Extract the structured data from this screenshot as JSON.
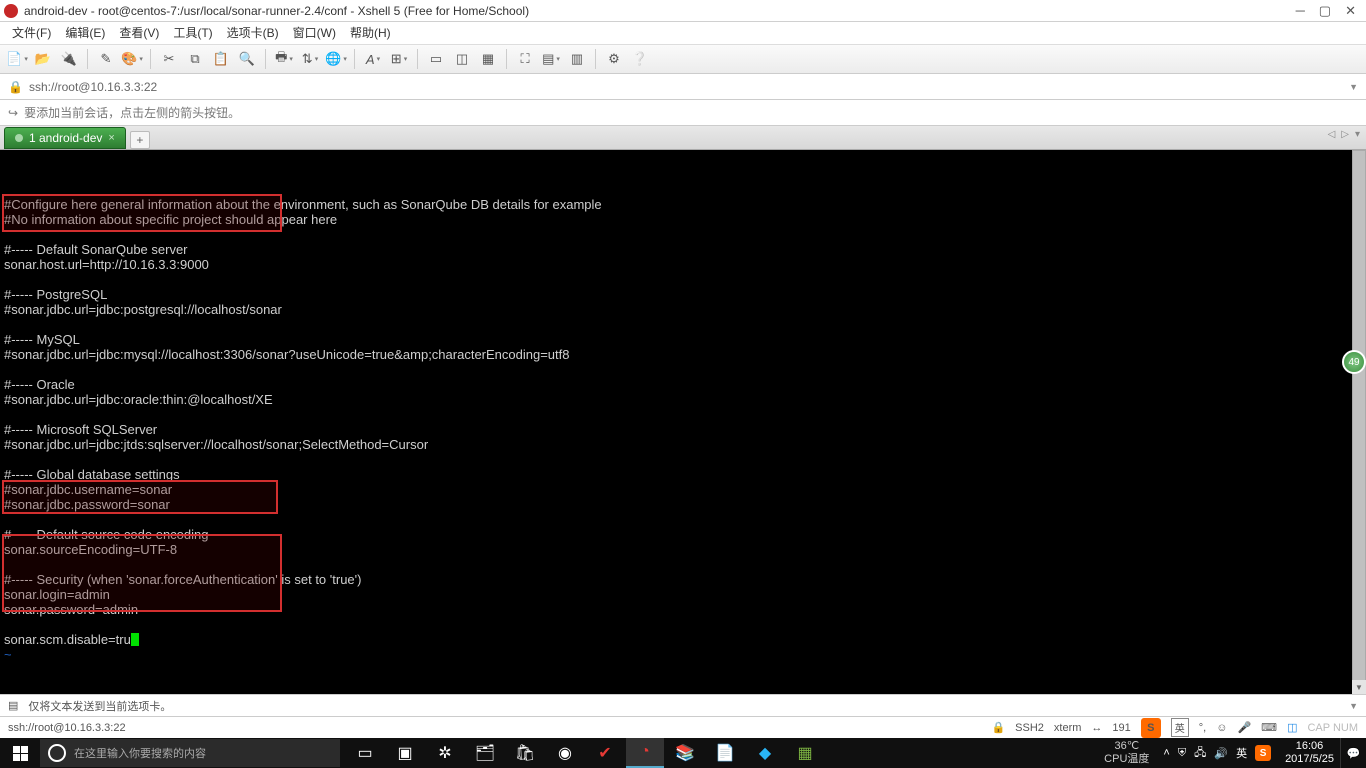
{
  "titlebar": {
    "text": "android-dev - root@centos-7:/usr/local/sonar-runner-2.4/conf - Xshell 5 (Free for Home/School)"
  },
  "menu": [
    "文件(F)",
    "编辑(E)",
    "查看(V)",
    "工具(T)",
    "选项卡(B)",
    "窗口(W)",
    "帮助(H)"
  ],
  "address": "ssh://root@10.16.3.3:22",
  "hint": "要添加当前会话，点击左侧的箭头按钮。",
  "tab": {
    "label": "1 android-dev"
  },
  "terminal": {
    "lines": [
      "#Configure here general information about the environment, such as SonarQube DB details for example",
      "#No information about specific project should appear here",
      "",
      "#----- Default SonarQube server",
      "sonar.host.url=http://10.16.3.3:9000",
      "",
      "#----- PostgreSQL",
      "#sonar.jdbc.url=jdbc:postgresql://localhost/sonar",
      "",
      "#----- MySQL",
      "#sonar.jdbc.url=jdbc:mysql://localhost:3306/sonar?useUnicode=true&amp;characterEncoding=utf8",
      "",
      "#----- Oracle",
      "#sonar.jdbc.url=jdbc:oracle:thin:@localhost/XE",
      "",
      "#----- Microsoft SQLServer",
      "#sonar.jdbc.url=jdbc:jtds:sqlserver://localhost/sonar;SelectMethod=Cursor",
      "",
      "#----- Global database settings",
      "#sonar.jdbc.username=sonar",
      "#sonar.jdbc.password=sonar",
      "",
      "#----- Default source code encoding",
      "sonar.sourceEncoding=UTF-8",
      "",
      "#----- Security (when 'sonar.forceAuthentication' is set to 'true')",
      "sonar.login=admin",
      "sonar.password=admin",
      "",
      "sonar.scm.disable=tru"
    ],
    "badge": "49"
  },
  "status1": "仅将文本发送到当前选项卡。",
  "status2": {
    "left": "ssh://root@10.16.3.3:22",
    "ssh": "SSH2",
    "term": "xterm",
    "size": "191",
    "caps": "CAP  NUM"
  },
  "taskbar": {
    "search_placeholder": "在这里输入你要搜索的内容",
    "temp1": "36℃",
    "temp2": "CPU温度",
    "lang": "英",
    "time": "16:06",
    "date": "2017/5/25"
  }
}
